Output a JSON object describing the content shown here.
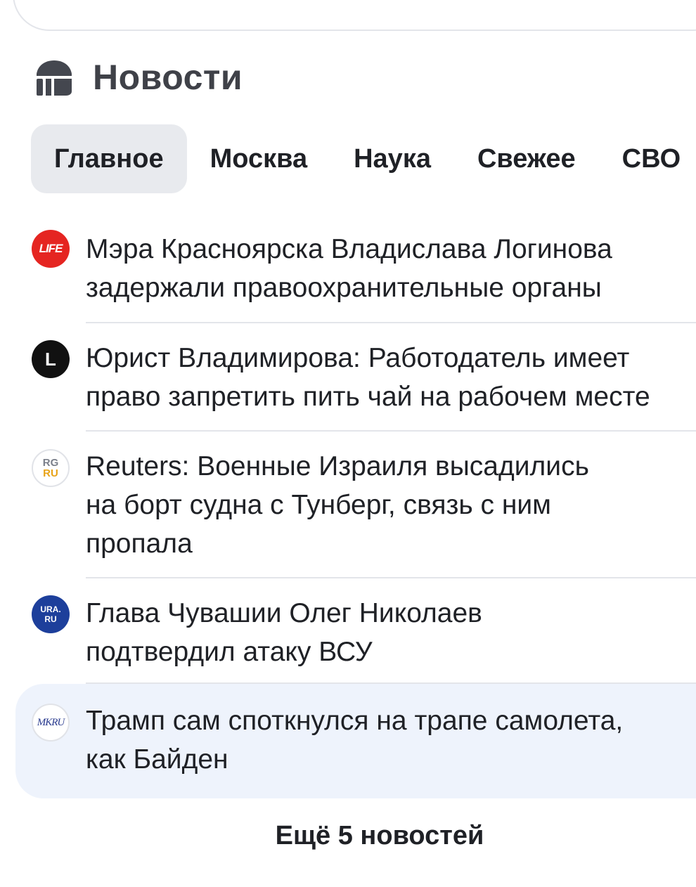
{
  "header": {
    "title": "Новости",
    "logo_icon": "news-logo-icon"
  },
  "tabs": [
    {
      "label": "Главное",
      "active": true
    },
    {
      "label": "Москва",
      "active": false
    },
    {
      "label": "Наука",
      "active": false
    },
    {
      "label": "Свежее",
      "active": false
    },
    {
      "label": "СВО",
      "active": false
    }
  ],
  "news": [
    {
      "source_logo_text": "LIFE",
      "lines": [
        "Мэра Красноярска Владислава Логинова",
        "задержали правоохранительные органы"
      ]
    },
    {
      "source_logo_text": "L",
      "lines": [
        "Юрист Владимирова: Работодатель имеет",
        "право запретить пить чай на рабочем месте"
      ]
    },
    {
      "source_logo_text_top": "RG",
      "source_logo_text_bottom": "RU",
      "lines": [
        "Reuters: Военные Израиля высадились",
        "на борт судна с Тунберг, связь с ним",
        "пропала"
      ]
    },
    {
      "source_logo_text_top": "URA.",
      "source_logo_text_bottom": "RU",
      "lines": [
        "Глава Чувашии Олег Николаев",
        "подтвердил атаку ВСУ"
      ]
    },
    {
      "source_logo_text": "MKRU",
      "lines": [
        "Трамп сам споткнулся на трапе самолета,",
        "как Байден"
      ],
      "highlighted": true
    }
  ],
  "more_button": "Ещё 5 новостей",
  "colors": {
    "tab_active_bg": "#e8eaee",
    "highlight_bg": "#eef3fc",
    "life_red": "#e52521",
    "ura_blue": "#1d3f9b"
  }
}
